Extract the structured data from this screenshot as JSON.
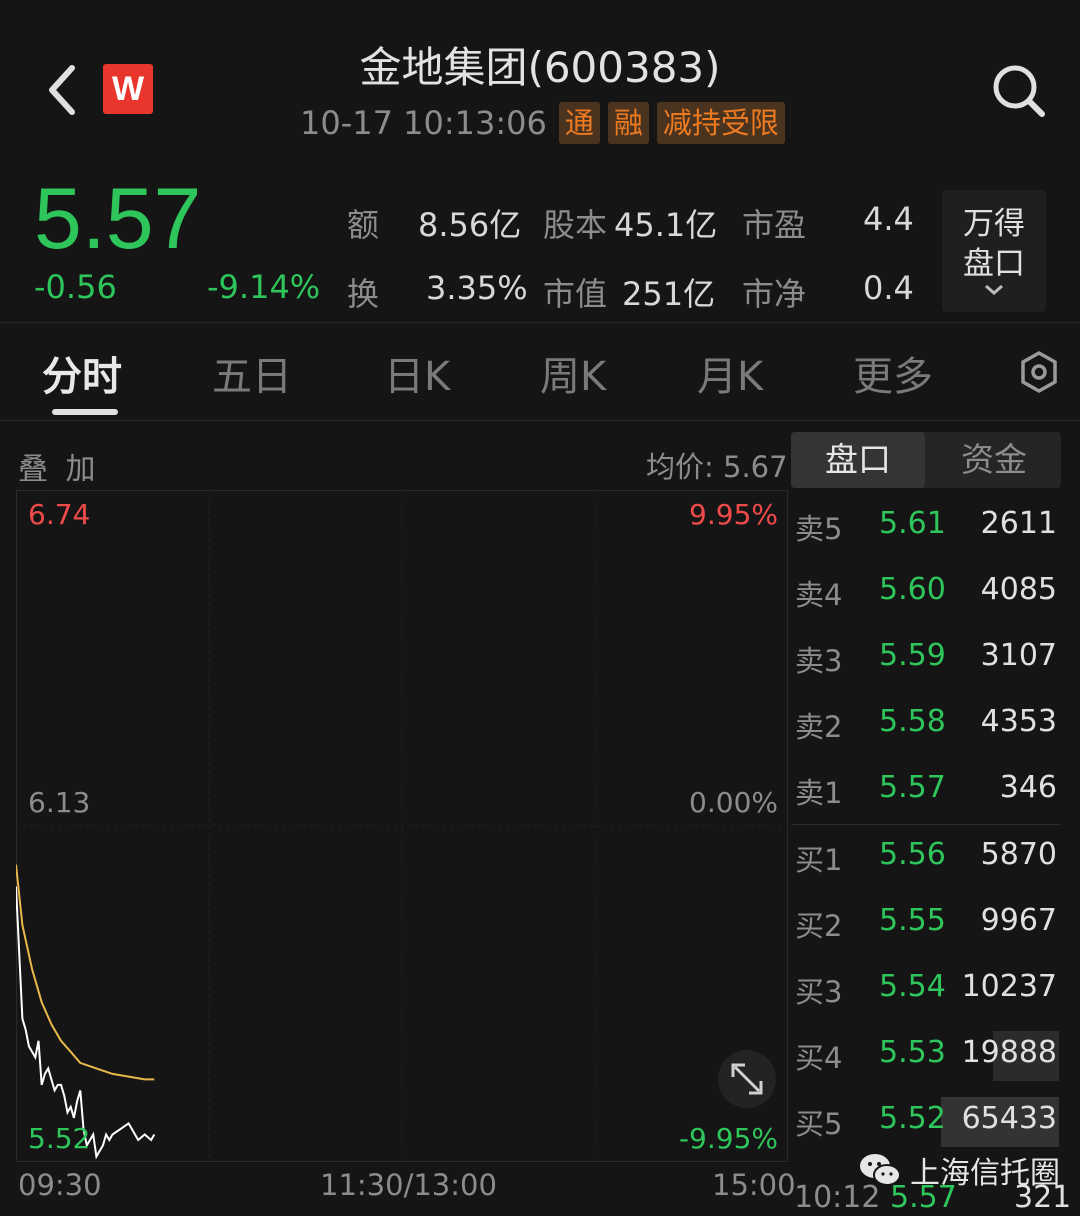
{
  "header": {
    "title": "金地集团(600383)",
    "timestamp": "10-17 10:13:06",
    "tags": [
      "通",
      "融",
      "减持受限"
    ],
    "logo_letter": "W"
  },
  "quote": {
    "price": "5.57",
    "change": "-0.56",
    "change_pct": "-9.14%",
    "stats": [
      {
        "label": "额",
        "value": "8.56亿"
      },
      {
        "label": "股本",
        "value": "45.1亿"
      },
      {
        "label": "市盈",
        "value": "4.4"
      },
      {
        "label": "换",
        "value": "3.35%"
      },
      {
        "label": "市值",
        "value": "251亿"
      },
      {
        "label": "市净",
        "value": "0.4"
      }
    ],
    "wande_button": [
      "万得",
      "盘口"
    ]
  },
  "tabs": [
    "分时",
    "五日",
    "日K",
    "周K",
    "月K",
    "更多"
  ],
  "chart": {
    "overlay_label": "叠 加",
    "avg_price": "均价: 5.67",
    "y_left": {
      "top": "6.74",
      "mid": "6.13",
      "bottom": "5.52"
    },
    "y_right": {
      "top": "9.95%",
      "mid": "0.00%",
      "bottom": "-9.95%"
    },
    "x_labels": [
      "09:30",
      "11:30/13:00",
      "15:00"
    ]
  },
  "chart_data": {
    "type": "line",
    "ylim": [
      5.52,
      6.74
    ],
    "series": [
      {
        "x": [
          "09:30",
          "09:31",
          "09:32",
          "09:33",
          "09:34",
          "09:35",
          "09:36",
          "09:37",
          "09:38",
          "09:39",
          "09:40",
          "09:41",
          "09:42",
          "09:43",
          "09:44",
          "09:45",
          "09:46",
          "09:47",
          "09:48",
          "09:49",
          "09:50",
          "09:51",
          "09:52",
          "09:53",
          "09:54",
          "09:55",
          "09:56",
          "09:57",
          "09:58",
          "09:59",
          "10:00",
          "10:05",
          "10:08",
          "10:10",
          "10:12",
          "10:13"
        ],
        "values": [
          6.02,
          5.9,
          5.78,
          5.76,
          5.73,
          5.72,
          5.71,
          5.74,
          5.66,
          5.68,
          5.69,
          5.67,
          5.65,
          5.66,
          5.66,
          5.64,
          5.61,
          5.62,
          5.6,
          5.63,
          5.65,
          5.58,
          5.55,
          5.56,
          5.57,
          5.53,
          5.54,
          5.55,
          5.57,
          5.56,
          5.57,
          5.59,
          5.56,
          5.57,
          5.56,
          5.57
        ],
        "color": "#ffffff"
      },
      {
        "x": [
          "09:30",
          "09:32",
          "09:35",
          "09:38",
          "09:41",
          "09:44",
          "09:47",
          "09:50",
          "09:55",
          "10:00",
          "10:05",
          "10:10",
          "10:13"
        ],
        "values": [
          6.06,
          5.95,
          5.87,
          5.81,
          5.77,
          5.74,
          5.72,
          5.7,
          5.69,
          5.68,
          5.675,
          5.67,
          5.67
        ],
        "color": "#e8b84a"
      }
    ]
  },
  "panel": {
    "tab_book": "盘口",
    "tab_fund": "资金",
    "asks": [
      {
        "label": "卖5",
        "price": "5.61",
        "vol": "2611"
      },
      {
        "label": "卖4",
        "price": "5.60",
        "vol": "4085"
      },
      {
        "label": "卖3",
        "price": "5.59",
        "vol": "3107"
      },
      {
        "label": "卖2",
        "price": "5.58",
        "vol": "4353"
      },
      {
        "label": "卖1",
        "price": "5.57",
        "vol": "346"
      }
    ],
    "bids": [
      {
        "label": "买1",
        "price": "5.56",
        "vol": "5870"
      },
      {
        "label": "买2",
        "price": "5.55",
        "vol": "9967"
      },
      {
        "label": "买3",
        "price": "5.54",
        "vol": "10237"
      },
      {
        "label": "买4",
        "price": "5.53",
        "vol": "19888"
      },
      {
        "label": "买5",
        "price": "5.52",
        "vol": "65433"
      }
    ],
    "last_trade": {
      "time": "10:12",
      "price": "5.57",
      "vol": "321"
    }
  },
  "watermark": "上海信托圈",
  "colors": {
    "down": "#2ec55b",
    "up": "#f04a4a",
    "tag": "#ee7a1f",
    "avg_line": "#e8b84a"
  }
}
